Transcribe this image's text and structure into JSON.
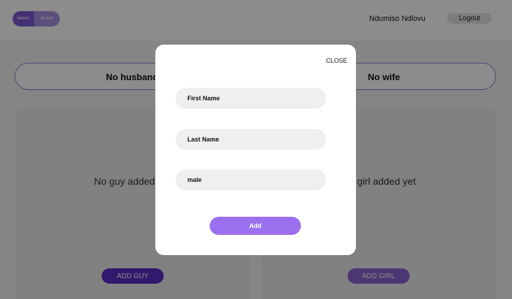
{
  "header": {
    "logo_left": "MARRY",
    "logo_right": "ME APP",
    "user_name": "Ndumiso Ndlovu",
    "logout_label": "Logout"
  },
  "status": {
    "left_label": "No husband",
    "right_label": "No wife"
  },
  "panels": {
    "left": {
      "empty_text": "No guy added yet",
      "button_label": "ADD GUY"
    },
    "right": {
      "empty_text": "No girl added yet",
      "button_label": "ADD GIRL"
    }
  },
  "modal": {
    "close_label": "CLOSE",
    "first_name_placeholder": "First Name",
    "last_name_placeholder": "Last Name",
    "gender_value": "male",
    "submit_label": "Add"
  },
  "colors": {
    "accent": "#9b70ee",
    "accent_dark": "#5a2fc7",
    "border": "#8a7ad6"
  }
}
